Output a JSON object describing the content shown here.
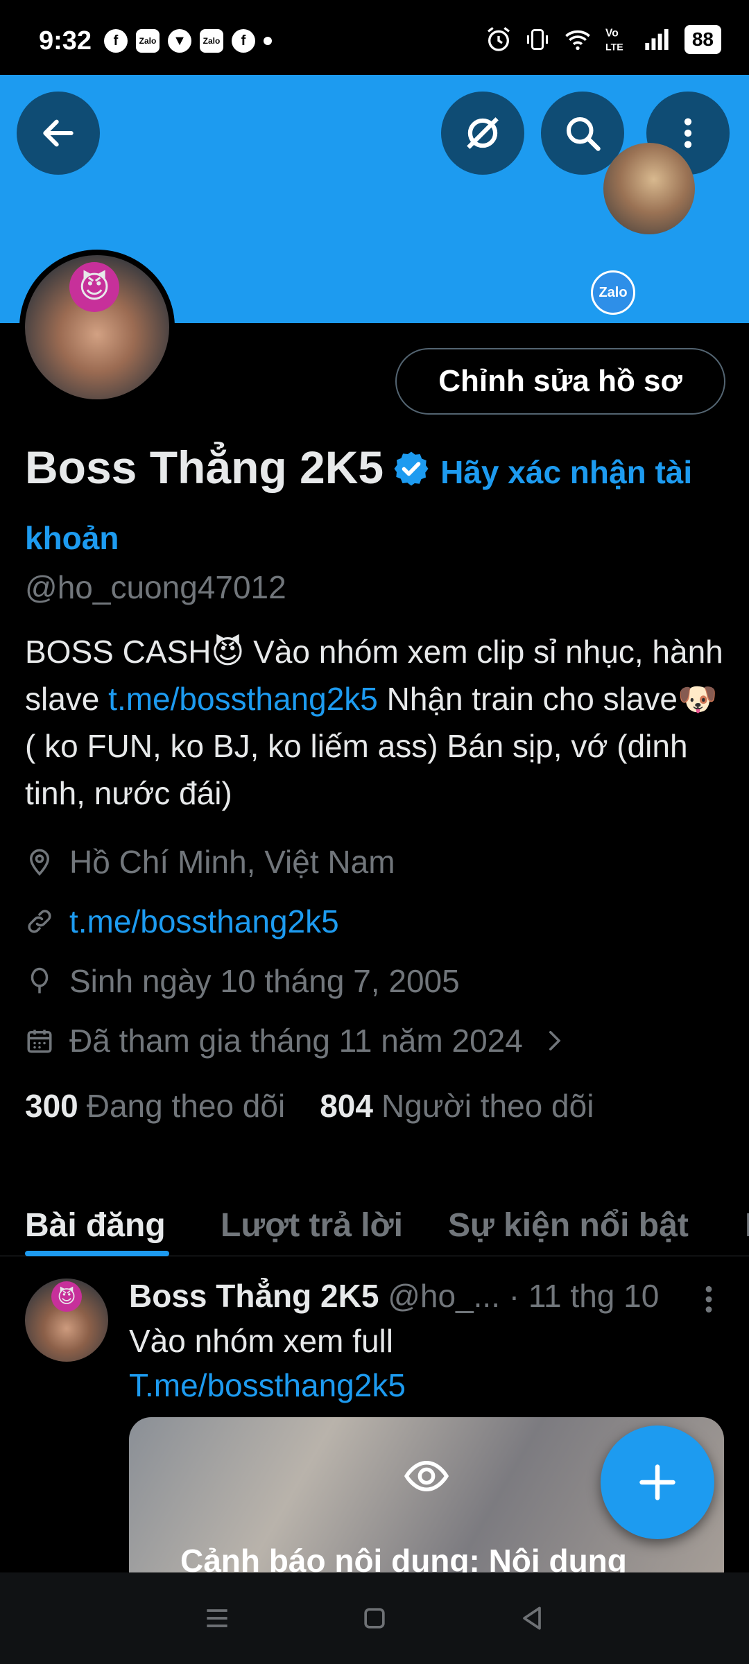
{
  "status_bar": {
    "time": "9:32",
    "left_icons": [
      "facebook-icon",
      "zalo-icon",
      "shield-icon",
      "zalo-icon",
      "facebook-icon",
      "dot-icon"
    ],
    "right_icons": [
      "alarm-icon",
      "vibrate-icon",
      "wifi-icon",
      "volte-icon",
      "signal-icon"
    ],
    "volte_label": "Vo\nLTE",
    "battery": "88"
  },
  "banner": {
    "color": "#1d9bf0",
    "zalo_label": "Zalo"
  },
  "profile": {
    "edit_button": "Chỉnh sửa hồ sơ",
    "display_name": "Boss Thẳng 2K5",
    "verify_prompt": "Hãy xác nhận tài khoản",
    "handle": "@ho_cuong47012",
    "bio_part1": "BOSS CASH😈 Vào nhóm xem clip sỉ nhục, hành slave ",
    "bio_link": "t.me/bossthang2k5",
    "bio_part2": " Nhận train cho slave🐶( ko FUN, ko BJ, ko liếm ass) Bán sịp, vớ (dinh tinh, nước đái)",
    "location": "Hồ Chí Minh, Việt Nam",
    "website": "t.me/bossthang2k5",
    "birthday": "Sinh ngày 10 tháng 7, 2005",
    "joined": "Đã tham gia tháng 11 năm 2024",
    "following_count": "300",
    "following_label": "Đang theo dõi",
    "followers_count": "804",
    "followers_label": "Người theo dõi"
  },
  "tabs": [
    {
      "label": "Bài đăng",
      "active": true
    },
    {
      "label": "Lượt trả lời",
      "active": false
    },
    {
      "label": "Sự kiện nổi bật",
      "active": false
    },
    {
      "label": "B",
      "active": false
    }
  ],
  "post": {
    "name": "Boss Thẳng 2K5",
    "handle": "@ho_...",
    "time": "· 11 thg 10",
    "text_line1": "Vào nhóm xem full",
    "text_link": "T.me/bossthang2k5",
    "media_warning": "Cảnh báo nội dung: Nội dung"
  },
  "colors": {
    "accent": "#1d9bf0",
    "muted_text": "#71767b",
    "background": "#000000"
  }
}
